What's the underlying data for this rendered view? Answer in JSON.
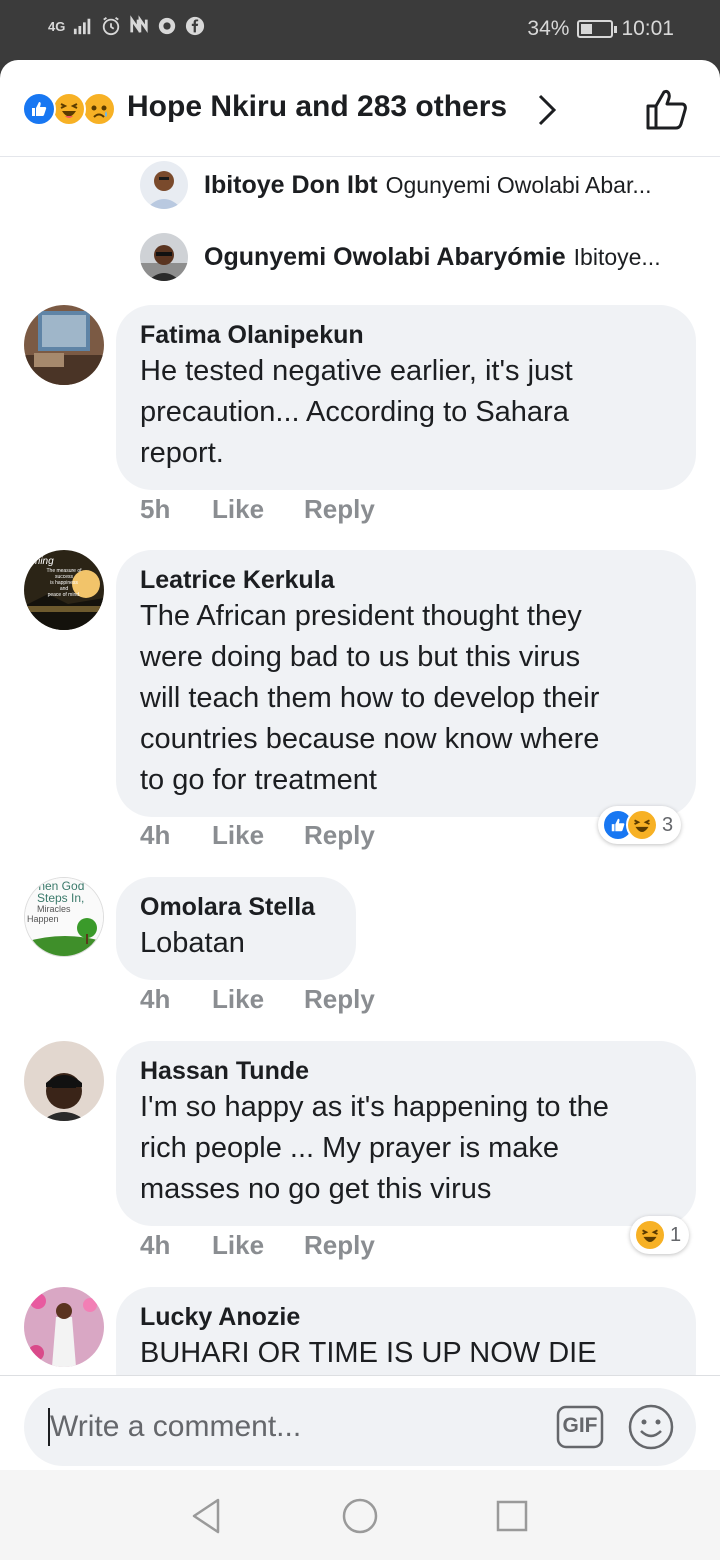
{
  "status_bar": {
    "network": "4G",
    "battery": "34%",
    "battery_level": 0.34,
    "time": "10:01",
    "icons": [
      "signal-icon",
      "alarm-icon",
      "nfc-icon",
      "vpn-icon",
      "facebook-icon"
    ]
  },
  "header": {
    "reactions": [
      "like",
      "haha",
      "sad"
    ],
    "reactions_text": "Hope Nkiru and 283 others"
  },
  "replies": [
    {
      "name": "Ibitoye Don Ibt",
      "snippet": "Ogunyemi Owolabi Abar..."
    },
    {
      "name": "Ogunyemi Owolabi Abaryómie",
      "snippet": "Ibitoye..."
    }
  ],
  "comments": [
    {
      "name": "Fatima Olanipekun",
      "lines": [
        "He tested negative earlier,  it's just",
        "precaution... According to Sahara",
        "report."
      ],
      "age": "5h",
      "like": "Like",
      "reply": "Reply"
    },
    {
      "name": "Leatrice Kerkula",
      "lines": [
        "The African president thought they",
        "were doing bad to us but this virus",
        "will teach them how to develop their",
        "countries because now know where",
        "to go for treatment"
      ],
      "age": "4h",
      "like": "Like",
      "reply": "Reply",
      "reaction_count": "3",
      "avatar_text": [
        "The measure of",
        "success",
        "is happiness",
        "and",
        "peace of mind."
      ]
    },
    {
      "name": "Omolara Stella",
      "lines": [
        "Lobatan"
      ],
      "age": "4h",
      "like": "Like",
      "reply": "Reply",
      "avatar_text": [
        "When God",
        "Steps In,",
        "Miracles",
        "Happen"
      ]
    },
    {
      "name": "Hassan Tunde",
      "lines": [
        "I'm so happy as it's happening to the",
        "rich people ... My prayer is make",
        "masses no go get this virus"
      ],
      "age": "4h",
      "like": "Like",
      "reply": "Reply",
      "reaction_count": "1"
    },
    {
      "name": "Lucky Anozie",
      "lines": [
        "BUHARI OR TIME IS UP NOW DIE"
      ]
    }
  ],
  "composer": {
    "placeholder": "Write a comment...",
    "gif_label": "GIF"
  },
  "colors": {
    "facebook_blue": "#1877f2",
    "reaction_yellow": "#f7b125",
    "bubble_gray": "#f0f2f5",
    "meta_gray": "#8a8d91"
  }
}
